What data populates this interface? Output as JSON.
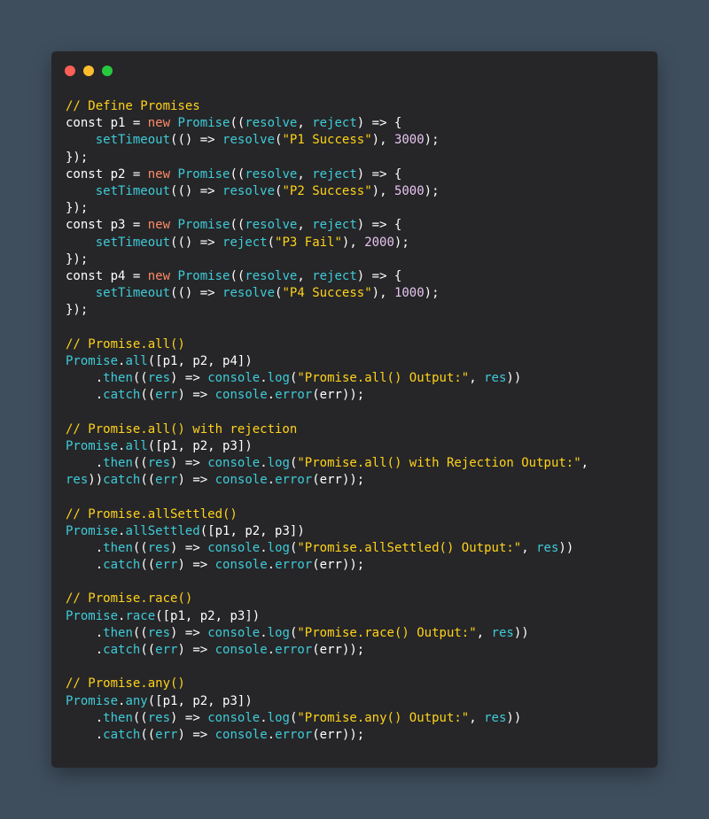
{
  "window": {
    "controls": [
      {
        "name": "close-dot",
        "color": "#ff5f56"
      },
      {
        "name": "minimize-dot",
        "color": "#ffbd2e"
      },
      {
        "name": "maximize-dot",
        "color": "#27c93f"
      }
    ]
  },
  "colors": {
    "background": "#3f4e5d",
    "window": "#262628",
    "comment": "#ffd21a",
    "plain": "#ffffff",
    "keyword_new": "#ff8a65",
    "identifier": "#3ecbd8",
    "string": "#ffd21a",
    "number": "#e6c4f0"
  },
  "code": {
    "lines": [
      [
        [
          "comment",
          "// Define Promises"
        ]
      ],
      [
        [
          "plain",
          "const p1 = "
        ],
        [
          "keyword_new",
          "new"
        ],
        [
          "plain",
          " "
        ],
        [
          "identifier",
          "Promise"
        ],
        [
          "plain",
          "(("
        ],
        [
          "identifier",
          "resolve"
        ],
        [
          "plain",
          ", "
        ],
        [
          "identifier",
          "reject"
        ],
        [
          "plain",
          ") => {"
        ]
      ],
      [
        [
          "plain",
          "    "
        ],
        [
          "identifier",
          "setTimeout"
        ],
        [
          "plain",
          "(() => "
        ],
        [
          "identifier",
          "resolve"
        ],
        [
          "plain",
          "("
        ],
        [
          "string",
          "\"P1 Success\""
        ],
        [
          "plain",
          "), "
        ],
        [
          "number",
          "3000"
        ],
        [
          "plain",
          ");"
        ]
      ],
      [
        [
          "plain",
          "});"
        ]
      ],
      [
        [
          "plain",
          "const p2 = "
        ],
        [
          "keyword_new",
          "new"
        ],
        [
          "plain",
          " "
        ],
        [
          "identifier",
          "Promise"
        ],
        [
          "plain",
          "(("
        ],
        [
          "identifier",
          "resolve"
        ],
        [
          "plain",
          ", "
        ],
        [
          "identifier",
          "reject"
        ],
        [
          "plain",
          ") => {"
        ]
      ],
      [
        [
          "plain",
          "    "
        ],
        [
          "identifier",
          "setTimeout"
        ],
        [
          "plain",
          "(() => "
        ],
        [
          "identifier",
          "resolve"
        ],
        [
          "plain",
          "("
        ],
        [
          "string",
          "\"P2 Success\""
        ],
        [
          "plain",
          "), "
        ],
        [
          "number",
          "5000"
        ],
        [
          "plain",
          ");"
        ]
      ],
      [
        [
          "plain",
          "});"
        ]
      ],
      [
        [
          "plain",
          "const p3 = "
        ],
        [
          "keyword_new",
          "new"
        ],
        [
          "plain",
          " "
        ],
        [
          "identifier",
          "Promise"
        ],
        [
          "plain",
          "(("
        ],
        [
          "identifier",
          "resolve"
        ],
        [
          "plain",
          ", "
        ],
        [
          "identifier",
          "reject"
        ],
        [
          "plain",
          ") => {"
        ]
      ],
      [
        [
          "plain",
          "    "
        ],
        [
          "identifier",
          "setTimeout"
        ],
        [
          "plain",
          "(() => "
        ],
        [
          "identifier",
          "reject"
        ],
        [
          "plain",
          "("
        ],
        [
          "string",
          "\"P3 Fail\""
        ],
        [
          "plain",
          "), "
        ],
        [
          "number",
          "2000"
        ],
        [
          "plain",
          ");"
        ]
      ],
      [
        [
          "plain",
          "});"
        ]
      ],
      [
        [
          "plain",
          "const p4 = "
        ],
        [
          "keyword_new",
          "new"
        ],
        [
          "plain",
          " "
        ],
        [
          "identifier",
          "Promise"
        ],
        [
          "plain",
          "(("
        ],
        [
          "identifier",
          "resolve"
        ],
        [
          "plain",
          ", "
        ],
        [
          "identifier",
          "reject"
        ],
        [
          "plain",
          ") => {"
        ]
      ],
      [
        [
          "plain",
          "    "
        ],
        [
          "identifier",
          "setTimeout"
        ],
        [
          "plain",
          "(() => "
        ],
        [
          "identifier",
          "resolve"
        ],
        [
          "plain",
          "("
        ],
        [
          "string",
          "\"P4 Success\""
        ],
        [
          "plain",
          "), "
        ],
        [
          "number",
          "1000"
        ],
        [
          "plain",
          ");"
        ]
      ],
      [
        [
          "plain",
          "});"
        ]
      ],
      [],
      [
        [
          "comment",
          "// Promise.all()"
        ]
      ],
      [
        [
          "identifier",
          "Promise"
        ],
        [
          "plain",
          "."
        ],
        [
          "identifier",
          "all"
        ],
        [
          "plain",
          "([p1, p2, p4])"
        ]
      ],
      [
        [
          "plain",
          "    ."
        ],
        [
          "identifier",
          "then"
        ],
        [
          "plain",
          "(("
        ],
        [
          "identifier",
          "res"
        ],
        [
          "plain",
          ") => "
        ],
        [
          "identifier",
          "console"
        ],
        [
          "plain",
          "."
        ],
        [
          "identifier",
          "log"
        ],
        [
          "plain",
          "("
        ],
        [
          "string",
          "\"Promise.all() Output:\""
        ],
        [
          "plain",
          ", "
        ],
        [
          "identifier",
          "res"
        ],
        [
          "plain",
          "))"
        ]
      ],
      [
        [
          "plain",
          "    ."
        ],
        [
          "identifier",
          "catch"
        ],
        [
          "plain",
          "(("
        ],
        [
          "identifier",
          "err"
        ],
        [
          "plain",
          ") => "
        ],
        [
          "identifier",
          "console"
        ],
        [
          "plain",
          "."
        ],
        [
          "identifier",
          "error"
        ],
        [
          "plain",
          "(err));"
        ]
      ],
      [],
      [
        [
          "comment",
          "// Promise.all() with rejection"
        ]
      ],
      [
        [
          "identifier",
          "Promise"
        ],
        [
          "plain",
          "."
        ],
        [
          "identifier",
          "all"
        ],
        [
          "plain",
          "([p1, p2, p3])"
        ]
      ],
      [
        [
          "plain",
          "    ."
        ],
        [
          "identifier",
          "then"
        ],
        [
          "plain",
          "(("
        ],
        [
          "identifier",
          "res"
        ],
        [
          "plain",
          ") => "
        ],
        [
          "identifier",
          "console"
        ],
        [
          "plain",
          "."
        ],
        [
          "identifier",
          "log"
        ],
        [
          "plain",
          "("
        ],
        [
          "string",
          "\"Promise.all() with Rejection Output:\""
        ],
        [
          "plain",
          ","
        ]
      ],
      [
        [
          "identifier",
          "res"
        ],
        [
          "plain",
          "))"
        ],
        [
          "identifier",
          "catch"
        ],
        [
          "plain",
          "(("
        ],
        [
          "identifier",
          "err"
        ],
        [
          "plain",
          ") => "
        ],
        [
          "identifier",
          "console"
        ],
        [
          "plain",
          "."
        ],
        [
          "identifier",
          "error"
        ],
        [
          "plain",
          "(err));"
        ]
      ],
      [],
      [
        [
          "comment",
          "// Promise.allSettled()"
        ]
      ],
      [
        [
          "identifier",
          "Promise"
        ],
        [
          "plain",
          "."
        ],
        [
          "identifier",
          "allSettled"
        ],
        [
          "plain",
          "([p1, p2, p3])"
        ]
      ],
      [
        [
          "plain",
          "    ."
        ],
        [
          "identifier",
          "then"
        ],
        [
          "plain",
          "(("
        ],
        [
          "identifier",
          "res"
        ],
        [
          "plain",
          ") => "
        ],
        [
          "identifier",
          "console"
        ],
        [
          "plain",
          "."
        ],
        [
          "identifier",
          "log"
        ],
        [
          "plain",
          "("
        ],
        [
          "string",
          "\"Promise.allSettled() Output:\""
        ],
        [
          "plain",
          ", "
        ],
        [
          "identifier",
          "res"
        ],
        [
          "plain",
          "))"
        ]
      ],
      [
        [
          "plain",
          "    ."
        ],
        [
          "identifier",
          "catch"
        ],
        [
          "plain",
          "(("
        ],
        [
          "identifier",
          "err"
        ],
        [
          "plain",
          ") => "
        ],
        [
          "identifier",
          "console"
        ],
        [
          "plain",
          "."
        ],
        [
          "identifier",
          "error"
        ],
        [
          "plain",
          "(err));"
        ]
      ],
      [],
      [
        [
          "comment",
          "// Promise.race()"
        ]
      ],
      [
        [
          "identifier",
          "Promise"
        ],
        [
          "plain",
          "."
        ],
        [
          "identifier",
          "race"
        ],
        [
          "plain",
          "([p1, p2, p3])"
        ]
      ],
      [
        [
          "plain",
          "    ."
        ],
        [
          "identifier",
          "then"
        ],
        [
          "plain",
          "(("
        ],
        [
          "identifier",
          "res"
        ],
        [
          "plain",
          ") => "
        ],
        [
          "identifier",
          "console"
        ],
        [
          "plain",
          "."
        ],
        [
          "identifier",
          "log"
        ],
        [
          "plain",
          "("
        ],
        [
          "string",
          "\"Promise.race() Output:\""
        ],
        [
          "plain",
          ", "
        ],
        [
          "identifier",
          "res"
        ],
        [
          "plain",
          "))"
        ]
      ],
      [
        [
          "plain",
          "    ."
        ],
        [
          "identifier",
          "catch"
        ],
        [
          "plain",
          "(("
        ],
        [
          "identifier",
          "err"
        ],
        [
          "plain",
          ") => "
        ],
        [
          "identifier",
          "console"
        ],
        [
          "plain",
          "."
        ],
        [
          "identifier",
          "error"
        ],
        [
          "plain",
          "(err));"
        ]
      ],
      [],
      [
        [
          "comment",
          "// Promise.any()"
        ]
      ],
      [
        [
          "identifier",
          "Promise"
        ],
        [
          "plain",
          "."
        ],
        [
          "identifier",
          "any"
        ],
        [
          "plain",
          "([p1, p2, p3])"
        ]
      ],
      [
        [
          "plain",
          "    ."
        ],
        [
          "identifier",
          "then"
        ],
        [
          "plain",
          "(("
        ],
        [
          "identifier",
          "res"
        ],
        [
          "plain",
          ") => "
        ],
        [
          "identifier",
          "console"
        ],
        [
          "plain",
          "."
        ],
        [
          "identifier",
          "log"
        ],
        [
          "plain",
          "("
        ],
        [
          "string",
          "\"Promise.any() Output:\""
        ],
        [
          "plain",
          ", "
        ],
        [
          "identifier",
          "res"
        ],
        [
          "plain",
          "))"
        ]
      ],
      [
        [
          "plain",
          "    ."
        ],
        [
          "identifier",
          "catch"
        ],
        [
          "plain",
          "(("
        ],
        [
          "identifier",
          "err"
        ],
        [
          "plain",
          ") => "
        ],
        [
          "identifier",
          "console"
        ],
        [
          "plain",
          "."
        ],
        [
          "identifier",
          "error"
        ],
        [
          "plain",
          "(err));"
        ]
      ]
    ]
  }
}
